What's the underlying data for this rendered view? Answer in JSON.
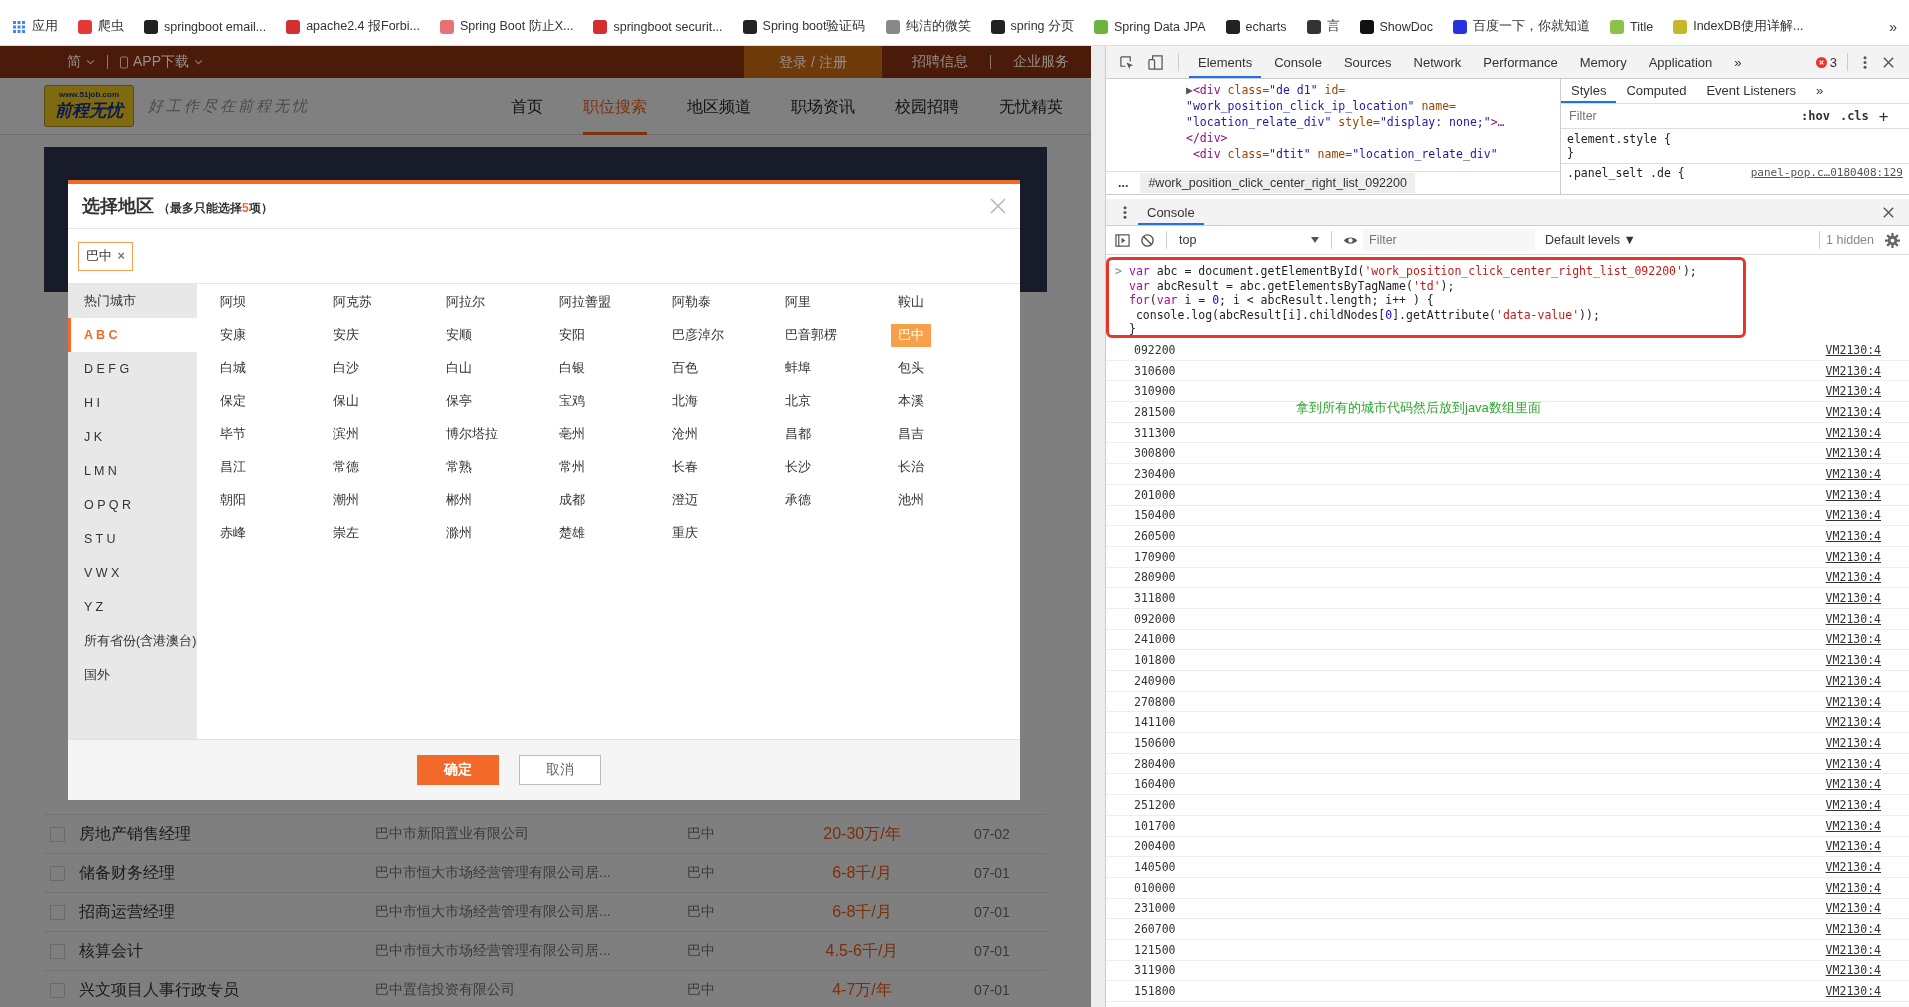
{
  "bookmarks_bar": {
    "items": [
      {
        "kind": "apps",
        "label": "应用",
        "color": "#4285f4"
      },
      {
        "kind": "site",
        "label": "爬虫",
        "color": "#e53935"
      },
      {
        "kind": "site",
        "label": "springboot email...",
        "color": "#222222"
      },
      {
        "kind": "site",
        "label": "apache2.4 报Forbi...",
        "color": "#d32f2f"
      },
      {
        "kind": "site",
        "label": "Spring Boot 防止X...",
        "color": "#e57373"
      },
      {
        "kind": "site",
        "label": "springboot securit...",
        "color": "#d32f2f"
      },
      {
        "kind": "site",
        "label": "Spring boot验证码",
        "color": "#222222"
      },
      {
        "kind": "site",
        "label": "纯洁的微笑",
        "color": "#888888"
      },
      {
        "kind": "site",
        "label": "spring 分页",
        "color": "#222222"
      },
      {
        "kind": "site",
        "label": "Spring Data JPA",
        "color": "#6db33f"
      },
      {
        "kind": "site",
        "label": "echarts",
        "color": "#222222"
      },
      {
        "kind": "site",
        "label": "言",
        "color": "#333333"
      },
      {
        "kind": "site",
        "label": "ShowDoc",
        "color": "#111111"
      },
      {
        "kind": "site",
        "label": "百度一下，你就知道",
        "color": "#2932e1"
      },
      {
        "kind": "site",
        "label": "Title",
        "color": "#8bc34a"
      },
      {
        "kind": "site",
        "label": "IndexDB使用详解...",
        "color": "#c5b82b"
      }
    ],
    "more": "»"
  },
  "site": {
    "top_bar": {
      "language": "简",
      "app_download": "APP下载",
      "login": "登录 / 注册",
      "links": [
        "招聘信息",
        "企业服务"
      ]
    },
    "header": {
      "logo_url": "www.51job.com",
      "logo_name": "前程无忧",
      "slogan": "好工作尽在前程无忧",
      "nav": [
        {
          "label": "首页",
          "selected": false
        },
        {
          "label": "职位搜索",
          "selected": true
        },
        {
          "label": "地区频道",
          "selected": false
        },
        {
          "label": "职场资讯",
          "selected": false
        },
        {
          "label": "校园招聘",
          "selected": false
        },
        {
          "label": "无忧精英",
          "selected": false
        }
      ]
    },
    "jobs": [
      {
        "title": "房地产销售经理",
        "company": "巴中市新阳置业有限公司",
        "location": "巴中",
        "salary": "20-30万/年",
        "date": "07-02",
        "checked": false
      },
      {
        "title": "储备财务经理",
        "company": "巴中市恒大市场经营管理有限公司居...",
        "location": "巴中",
        "salary": "6-8千/月",
        "date": "07-01",
        "checked": false
      },
      {
        "title": "招商运营经理",
        "company": "巴中市恒大市场经营管理有限公司居...",
        "location": "巴中",
        "salary": "6-8千/月",
        "date": "07-01",
        "checked": false
      },
      {
        "title": "核算会计",
        "company": "巴中市恒大市场经营管理有限公司居...",
        "location": "巴中",
        "salary": "4.5-6千/月",
        "date": "07-01",
        "checked": false
      },
      {
        "title": "兴文项目人事行政专员",
        "company": "巴中置信投资有限公司",
        "location": "巴中",
        "salary": "4-7万/年",
        "date": "07-01",
        "checked": false
      }
    ],
    "dialog": {
      "title": "选择地区",
      "note_before": "（最多只能选择",
      "note_count": "5",
      "note_after": "项）",
      "tags": [
        {
          "label": "巴中",
          "remove": "×"
        }
      ],
      "categories": [
        {
          "label": "热门城市",
          "selected": false
        },
        {
          "label": "A B C",
          "selected": true
        },
        {
          "label": "D E F G",
          "selected": false
        },
        {
          "label": "H I",
          "selected": false
        },
        {
          "label": "J K",
          "selected": false
        },
        {
          "label": "L M N",
          "selected": false
        },
        {
          "label": "O P Q R",
          "selected": false
        },
        {
          "label": "S T U",
          "selected": false
        },
        {
          "label": "V W X",
          "selected": false
        },
        {
          "label": "Y Z",
          "selected": false
        },
        {
          "label": "所有省份(含港澳台)",
          "selected": false
        },
        {
          "label": "国外",
          "selected": false
        }
      ],
      "cities": [
        {
          "label": "阿坝",
          "selected": false
        },
        {
          "label": "阿克苏",
          "selected": false
        },
        {
          "label": "阿拉尔",
          "selected": false
        },
        {
          "label": "阿拉善盟",
          "selected": false
        },
        {
          "label": "阿勒泰",
          "selected": false
        },
        {
          "label": "阿里",
          "selected": false
        },
        {
          "label": "鞍山",
          "selected": false
        },
        {
          "label": "安康",
          "selected": false
        },
        {
          "label": "安庆",
          "selected": false
        },
        {
          "label": "安顺",
          "selected": false
        },
        {
          "label": "安阳",
          "selected": false
        },
        {
          "label": "巴彦淖尔",
          "selected": false
        },
        {
          "label": "巴音郭楞",
          "selected": false
        },
        {
          "label": "巴中",
          "selected": true
        },
        {
          "label": "白城",
          "selected": false
        },
        {
          "label": "白沙",
          "selected": false
        },
        {
          "label": "白山",
          "selected": false
        },
        {
          "label": "白银",
          "selected": false
        },
        {
          "label": "百色",
          "selected": false
        },
        {
          "label": "蚌埠",
          "selected": false
        },
        {
          "label": "包头",
          "selected": false
        },
        {
          "label": "保定",
          "selected": false
        },
        {
          "label": "保山",
          "selected": false
        },
        {
          "label": "保亭",
          "selected": false
        },
        {
          "label": "宝鸡",
          "selected": false
        },
        {
          "label": "北海",
          "selected": false
        },
        {
          "label": "北京",
          "selected": false
        },
        {
          "label": "本溪",
          "selected": false
        },
        {
          "label": "毕节",
          "selected": false
        },
        {
          "label": "滨州",
          "selected": false
        },
        {
          "label": "博尔塔拉",
          "selected": false
        },
        {
          "label": "亳州",
          "selected": false
        },
        {
          "label": "沧州",
          "selected": false
        },
        {
          "label": "昌都",
          "selected": false
        },
        {
          "label": "昌吉",
          "selected": false
        },
        {
          "label": "昌江",
          "selected": false
        },
        {
          "label": "常德",
          "selected": false
        },
        {
          "label": "常熟",
          "selected": false
        },
        {
          "label": "常州",
          "selected": false
        },
        {
          "label": "长春",
          "selected": false
        },
        {
          "label": "长沙",
          "selected": false
        },
        {
          "label": "长治",
          "selected": false
        },
        {
          "label": "朝阳",
          "selected": false
        },
        {
          "label": "潮州",
          "selected": false
        },
        {
          "label": "郴州",
          "selected": false
        },
        {
          "label": "成都",
          "selected": false
        },
        {
          "label": "澄迈",
          "selected": false
        },
        {
          "label": "承德",
          "selected": false
        },
        {
          "label": "池州",
          "selected": false
        },
        {
          "label": "赤峰",
          "selected": false
        },
        {
          "label": "崇左",
          "selected": false
        },
        {
          "label": "滁州",
          "selected": false
        },
        {
          "label": "楚雄",
          "selected": false
        },
        {
          "label": "重庆",
          "selected": false
        }
      ],
      "confirm": "确定",
      "cancel": "取消"
    }
  },
  "devtools": {
    "tabs": [
      {
        "label": "Elements",
        "selected": true
      },
      {
        "label": "Console",
        "selected": false
      },
      {
        "label": "Sources",
        "selected": false
      },
      {
        "label": "Network",
        "selected": false
      },
      {
        "label": "Performance",
        "selected": false
      },
      {
        "label": "Memory",
        "selected": false
      },
      {
        "label": "Application",
        "selected": false
      }
    ],
    "more_tabs": "»",
    "error_count": "3",
    "elements": [
      {
        "parts": [
          {
            "kind": "plain",
            "text": "▶"
          },
          {
            "kind": "tag",
            "text": "<div"
          },
          {
            "kind": "attr",
            "text": " class="
          },
          {
            "kind": "value",
            "text": "\"de d1\""
          },
          {
            "kind": "attr",
            "text": " id="
          }
        ]
      },
      {
        "parts": [
          {
            "kind": "value",
            "text": "\"work_position_click_ip_location\""
          },
          {
            "kind": "attr",
            "text": " name="
          }
        ]
      },
      {
        "parts": [
          {
            "kind": "value",
            "text": "\"location_relate_div\""
          },
          {
            "kind": "attr",
            "text": " style="
          },
          {
            "kind": "value",
            "text": "\"display: none;\""
          },
          {
            "kind": "tag",
            "text": ">…"
          }
        ]
      },
      {
        "parts": [
          {
            "kind": "tag",
            "text": "</div>"
          }
        ]
      },
      {
        "parts": [
          {
            "kind": "tag",
            "text": " <div"
          },
          {
            "kind": "attr",
            "text": " class="
          },
          {
            "kind": "value",
            "text": "\"dtit\""
          },
          {
            "kind": "attr",
            "text": " name="
          },
          {
            "kind": "value",
            "text": "\"location_relate_div\""
          }
        ]
      }
    ],
    "breadcrumb_more": "...",
    "breadcrumb": "#work_position_click_center_right_list_092200",
    "styles": {
      "tabs": [
        {
          "label": "Styles",
          "selected": true
        },
        {
          "label": "Computed",
          "selected": false
        },
        {
          "label": "Event Listeners",
          "selected": false
        }
      ],
      "more_tabs": "»",
      "filter_placeholder": "Filter",
      "hov": ":hov",
      "cls": ".cls",
      "add": "+",
      "rules": [
        {
          "selector": "element.style {",
          "close": "}"
        }
      ],
      "next_selector": ".panel_selt .de {",
      "next_source": "panel-pop.c…0180408:129"
    },
    "console": {
      "tab": {
        "label": "Console",
        "selected": true
      },
      "context": "top",
      "filter_placeholder": "Filter",
      "levels": "Default levels ▼",
      "hidden": "1 hidden",
      "prompt": ">",
      "input": [
        [
          {
            "kind": "keyword",
            "text": "var"
          },
          {
            "kind": "plain",
            "text": " abc = document.getElementById("
          },
          {
            "kind": "string",
            "text": "'work_position_click_center_right_list_092200'"
          },
          {
            "kind": "plain",
            "text": ");"
          }
        ],
        [
          {
            "kind": "keyword",
            "text": "var"
          },
          {
            "kind": "plain",
            "text": " abcResult = abc.getElementsByTagName("
          },
          {
            "kind": "string",
            "text": "'td'"
          },
          {
            "kind": "plain",
            "text": ");"
          }
        ],
        [
          {
            "kind": "keyword",
            "text": "for"
          },
          {
            "kind": "plain",
            "text": "("
          },
          {
            "kind": "keyword",
            "text": "var"
          },
          {
            "kind": "plain",
            "text": " i = "
          },
          {
            "kind": "number",
            "text": "0"
          },
          {
            "kind": "plain",
            "text": "; i < abcResult.length; i++ ) {"
          }
        ],
        [
          {
            "kind": "plain",
            "text": " console.log(abcResult[i].childNodes["
          },
          {
            "kind": "number",
            "text": "0"
          },
          {
            "kind": "plain",
            "text": "].getAttribute("
          },
          {
            "kind": "string",
            "text": "'data-value'"
          },
          {
            "kind": "plain",
            "text": "));"
          }
        ],
        [
          {
            "kind": "plain",
            "text": "}"
          }
        ]
      ],
      "note": "拿到所有的城市代码然后放到java数组里面",
      "output": [
        {
          "value": "092200",
          "source": "VM2130:4"
        },
        {
          "value": "310600",
          "source": "VM2130:4"
        },
        {
          "value": "310900",
          "source": "VM2130:4"
        },
        {
          "value": "281500",
          "source": "VM2130:4"
        },
        {
          "value": "311300",
          "source": "VM2130:4"
        },
        {
          "value": "300800",
          "source": "VM2130:4"
        },
        {
          "value": "230400",
          "source": "VM2130:4"
        },
        {
          "value": "201000",
          "source": "VM2130:4"
        },
        {
          "value": "150400",
          "source": "VM2130:4"
        },
        {
          "value": "260500",
          "source": "VM2130:4"
        },
        {
          "value": "170900",
          "source": "VM2130:4"
        },
        {
          "value": "280900",
          "source": "VM2130:4"
        },
        {
          "value": "311800",
          "source": "VM2130:4"
        },
        {
          "value": "092000",
          "source": "VM2130:4"
        },
        {
          "value": "241000",
          "source": "VM2130:4"
        },
        {
          "value": "101800",
          "source": "VM2130:4"
        },
        {
          "value": "240900",
          "source": "VM2130:4"
        },
        {
          "value": "270800",
          "source": "VM2130:4"
        },
        {
          "value": "141100",
          "source": "VM2130:4"
        },
        {
          "value": "150600",
          "source": "VM2130:4"
        },
        {
          "value": "280400",
          "source": "VM2130:4"
        },
        {
          "value": "160400",
          "source": "VM2130:4"
        },
        {
          "value": "251200",
          "source": "VM2130:4"
        },
        {
          "value": "101700",
          "source": "VM2130:4"
        },
        {
          "value": "200400",
          "source": "VM2130:4"
        },
        {
          "value": "140500",
          "source": "VM2130:4"
        },
        {
          "value": "010000",
          "source": "VM2130:4"
        },
        {
          "value": "231000",
          "source": "VM2130:4"
        },
        {
          "value": "260700",
          "source": "VM2130:4"
        },
        {
          "value": "121500",
          "source": "VM2130:4"
        },
        {
          "value": "311900",
          "source": "VM2130:4"
        },
        {
          "value": "151800",
          "source": "VM2130:4"
        }
      ]
    }
  }
}
